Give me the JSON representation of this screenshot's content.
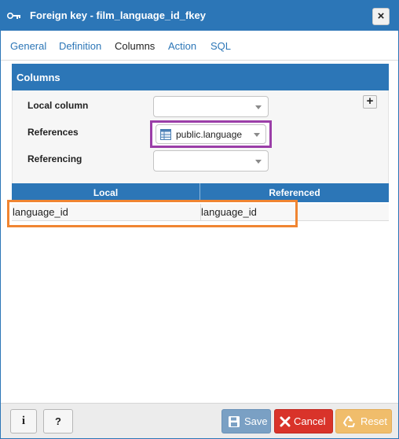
{
  "dialog": {
    "title": "Foreign key - film_language_id_fkey",
    "close_label": "×"
  },
  "tabs": [
    {
      "label": "General"
    },
    {
      "label": "Definition"
    },
    {
      "label": "Columns"
    },
    {
      "label": "Action"
    },
    {
      "label": "SQL"
    }
  ],
  "active_tab": "Columns",
  "columns_panel": {
    "heading": "Columns",
    "add_label": "+",
    "local_column_label": "Local column",
    "local_column_value": "",
    "references_label": "References",
    "references_value": "public.language",
    "referencing_label": "Referencing",
    "referencing_value": ""
  },
  "grid": {
    "headers": [
      "Local",
      "Referenced"
    ],
    "rows": [
      {
        "local": "language_id",
        "referenced": "language_id"
      }
    ]
  },
  "footer": {
    "info_label": "i",
    "help_label": "?",
    "save_label": "Save",
    "cancel_label": "Cancel",
    "reset_label": "Reset"
  },
  "colors": {
    "accent": "#2c76b7",
    "highlight_tab": "#e5131d",
    "highlight_references": "#9b3ea8",
    "highlight_row": "#f08532",
    "save": "#7aa0c4",
    "cancel": "#d9332a",
    "reset": "#f0bd6b"
  },
  "icons": {
    "title": "key-icon",
    "references": "table-icon",
    "save": "floppy-disk-icon",
    "cancel": "x-icon",
    "reset": "recycle-icon"
  }
}
